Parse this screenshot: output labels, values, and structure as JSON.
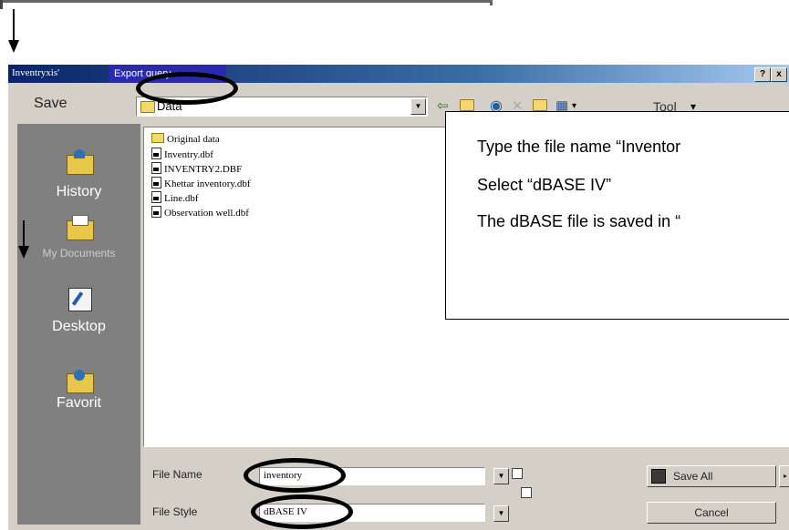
{
  "dialog": {
    "title": "Inventryxis'",
    "title_tag": "Export query",
    "help_btn": "?",
    "close_btn": "x",
    "save_label": "Save",
    "look_in": "Data",
    "tool_label": "Tool",
    "dropdown_arrow": "▼",
    "tool_arrow": "▾"
  },
  "places": [
    {
      "label": "History",
      "icon": "history-icon"
    },
    {
      "label": "My Documents",
      "icon": "my-documents-icon"
    },
    {
      "label": "Desktop",
      "icon": "desktop-icon"
    },
    {
      "label": "Favorit",
      "icon": "favorites-icon"
    }
  ],
  "files": [
    {
      "name": "Original data",
      "type": "folder"
    },
    {
      "name": "Inventry.dbf",
      "type": "file"
    },
    {
      "name": "INVENTRY2.DBF",
      "type": "file"
    },
    {
      "name": "Khettar inventory.dbf",
      "type": "file"
    },
    {
      "name": "Line.dbf",
      "type": "file"
    },
    {
      "name": "Observation well.dbf",
      "type": "file"
    }
  ],
  "annotation": {
    "line1": "Type the file name “Inventor",
    "line2": "Select “dBASE IV”",
    "line3": "The dBASE file is saved in “"
  },
  "form": {
    "file_name_label": "File Name",
    "file_name_value": "inventory",
    "file_style_label": "File Style",
    "file_style_value": "dBASE IV",
    "save_button": "Save All",
    "cancel_button": "Cancel"
  },
  "colors": {
    "title_active": "#0a246a",
    "title_tag": "#2a2ab0",
    "dialog_face": "#d4d0c8",
    "places_bar": "#808080"
  }
}
